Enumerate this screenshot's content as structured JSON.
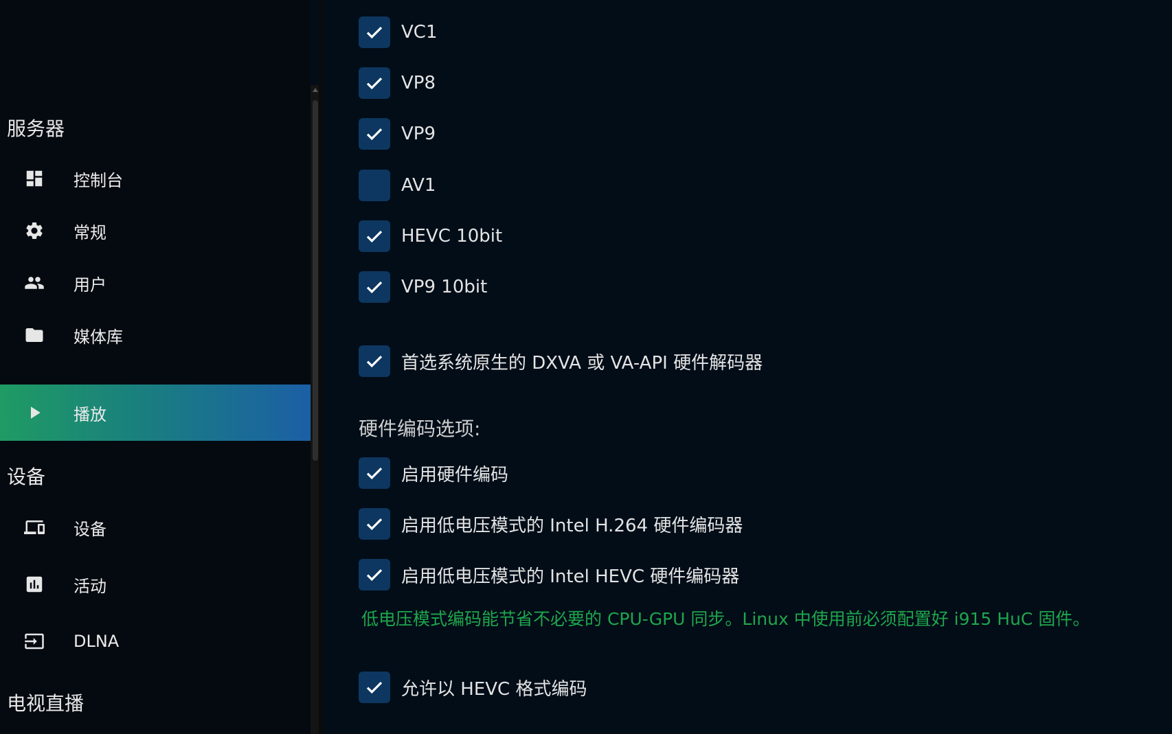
{
  "sidebar": {
    "sections": {
      "server": "服务器",
      "devices": "设备",
      "livetv": "电视直播"
    },
    "items": [
      {
        "label": "控制台",
        "icon": "dashboard-icon",
        "active": false
      },
      {
        "label": "常规",
        "icon": "gear-icon",
        "active": false
      },
      {
        "label": "用户",
        "icon": "users-icon",
        "active": false
      },
      {
        "label": "媒体库",
        "icon": "folder-icon",
        "active": false
      },
      {
        "label": "播放",
        "icon": "play-icon",
        "active": true
      },
      {
        "label": "设备",
        "icon": "devices-icon",
        "active": false
      },
      {
        "label": "活动",
        "icon": "chart-icon",
        "active": false
      },
      {
        "label": "DLNA",
        "icon": "input-icon",
        "active": false
      }
    ]
  },
  "main": {
    "codecs": [
      {
        "label": "VC1",
        "checked": true
      },
      {
        "label": "VP8",
        "checked": true
      },
      {
        "label": "VP9",
        "checked": true
      },
      {
        "label": "AV1",
        "checked": false
      },
      {
        "label": "HEVC 10bit",
        "checked": true
      },
      {
        "label": "VP9 10bit",
        "checked": true
      }
    ],
    "prefer_native": {
      "label": "首选系统原生的 DXVA 或 VA-API 硬件解码器",
      "checked": true
    },
    "encoding_title": "硬件编码选项:",
    "encoding_options": [
      {
        "label": "启用硬件编码",
        "checked": true
      },
      {
        "label": "启用低电压模式的 Intel H.264 硬件编码器",
        "checked": true
      },
      {
        "label": "启用低电压模式的 Intel HEVC 硬件编码器",
        "checked": true
      }
    ],
    "low_power_hint": "低电压模式编码能节省不必要的 CPU-GPU 同步。Linux 中使用前必须配置好 i915 HuC 固件。",
    "allow_hevc": {
      "label": "允许以 HEVC 格式编码",
      "checked": true
    }
  },
  "colors": {
    "accent_green": "#1fa64c",
    "checkbox_bg": "#0d3760",
    "active_gradient_start": "#1f9b63",
    "active_gradient_end": "#1b5fa6"
  }
}
